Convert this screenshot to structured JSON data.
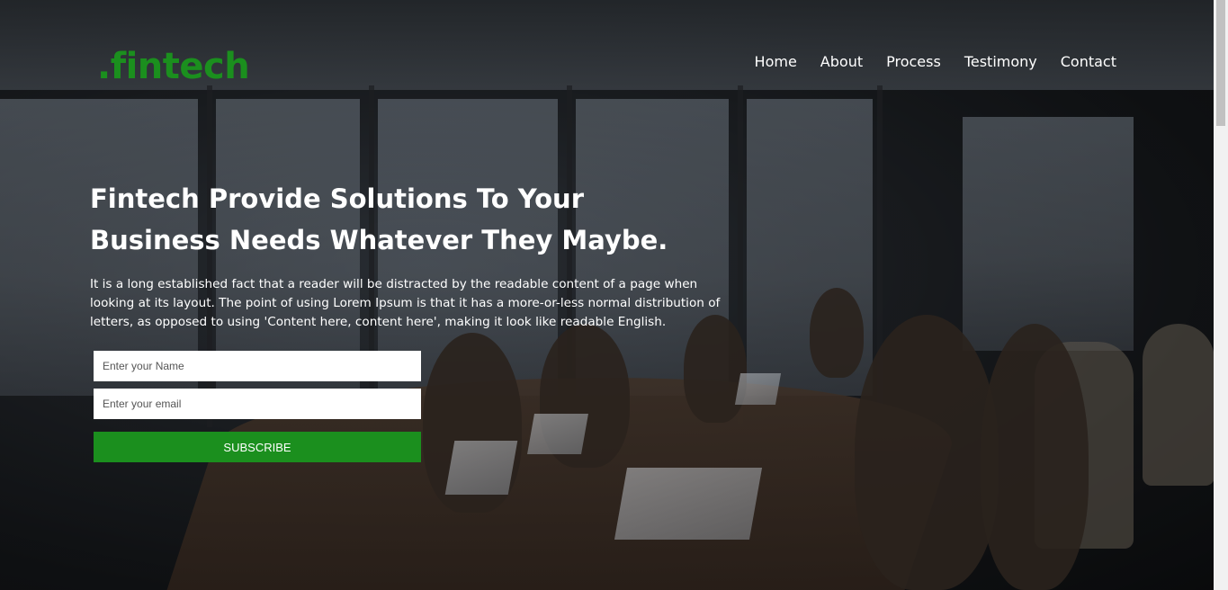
{
  "brand": {
    "logo": ".fintech",
    "accent_color": "#1b8f1e"
  },
  "nav": {
    "items": [
      {
        "label": "Home"
      },
      {
        "label": "About"
      },
      {
        "label": "Process"
      },
      {
        "label": "Testimony"
      },
      {
        "label": "Contact"
      }
    ]
  },
  "hero": {
    "headline": "Fintech Provide Solutions To Your Business Needs Whatever They Maybe.",
    "intro": "It is a long established fact that a reader will be distracted by the readable content of a page when looking at its layout. The point of using Lorem Ipsum is that it has a more-or-less normal distribution of letters, as opposed to using 'Content here, content here', making it look like readable English."
  },
  "form": {
    "name_placeholder": "Enter your Name",
    "email_placeholder": "Enter your email",
    "subscribe_label": "SUBSCRIBE"
  }
}
